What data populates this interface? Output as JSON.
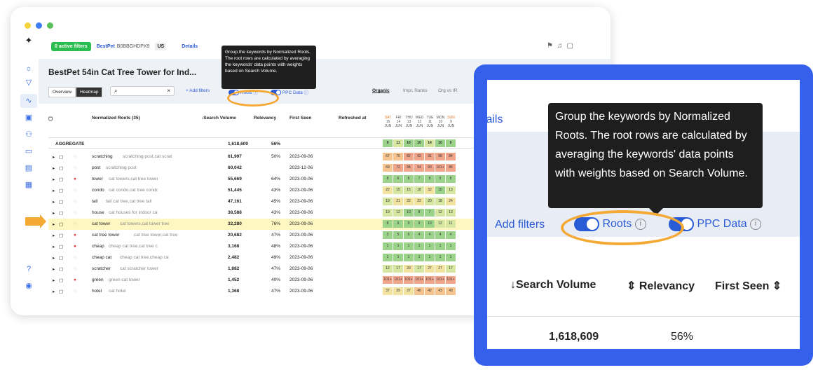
{
  "window": {
    "dot_colors": [
      "#f5d33b",
      "#3f7cf2",
      "#5ac05a"
    ]
  },
  "toolbar": {
    "filters": "0 active filters",
    "asin_prefix": "BestPet",
    "asin": "B0BBGHDPX9",
    "market": "US",
    "details": "Details"
  },
  "product": {
    "title": "BestPet 54in Cat Tree Tower for Ind..."
  },
  "tabs": {
    "overview": "Overview",
    "heatmap": "Heatmap"
  },
  "controls": {
    "add_filters": "+ Add filters",
    "roots": "Roots",
    "ppc": "PPC Data",
    "organic": "Organic",
    "impr": "Impr. Ranks",
    "orgvs": "Org vs IR"
  },
  "tooltip": "Group the keywords by Normalized Roots. The root rows are calculated by averaging the keywords' data points with weights based on Search Volume.",
  "table": {
    "headers": {
      "roots": "Normalized Roots (35)",
      "sv": "↓Search Volume",
      "rel": "Relevancy",
      "first": "First Seen",
      "refreshed": "Refreshed at"
    },
    "days": [
      [
        "SAT",
        "15",
        "JUN"
      ],
      [
        "FRI",
        "14",
        "JUN"
      ],
      [
        "THU",
        "13",
        "JUN"
      ],
      [
        "WED",
        "12",
        "JUN"
      ],
      [
        "TUE",
        "11",
        "JUN"
      ],
      [
        "MON",
        "10",
        "JUN"
      ],
      [
        "SUN",
        "9",
        "JUN"
      ]
    ],
    "aggregate": {
      "label": "AGGREGATE",
      "sv": "1,618,609",
      "rel": "56%",
      "cells": [
        "9",
        "11",
        "10",
        "10",
        "14",
        "10",
        "9"
      ]
    },
    "rows": [
      {
        "root": "scratching",
        "kw": "scratching post,cat scratc",
        "sv": "61,997",
        "rel": "50%",
        "first": "2023-09-06",
        "cells": [
          "67",
          "70",
          "82",
          "92",
          "91",
          "98",
          "84"
        ]
      },
      {
        "root": "post",
        "kw": "scratching post",
        "sv": "60,042",
        "rel": "",
        "first": "2023-12-06",
        "cells": [
          "69",
          "72",
          "84",
          "94",
          "93",
          "101+",
          "86"
        ]
      },
      {
        "root": "tower",
        "kw": "cat towers,cat tree tower,cat",
        "sv": "55,669",
        "rel": "64%",
        "first": "2023-09-06",
        "cells": [
          "8",
          "6",
          "8",
          "7",
          "8",
          "9",
          "8"
        ]
      },
      {
        "root": "condo",
        "kw": "cat condo,cat tree condo",
        "sv": "51,445",
        "rel": "43%",
        "first": "2023-09-06",
        "cells": [
          "22",
          "15",
          "15",
          "18",
          "32",
          "10",
          "13"
        ]
      },
      {
        "root": "tall",
        "kw": "tall cat tree,cat tree tall",
        "sv": "47,161",
        "rel": "45%",
        "first": "2023-09-06",
        "cells": [
          "19",
          "21",
          "22",
          "22",
          "20",
          "18",
          "24"
        ]
      },
      {
        "root": "house",
        "kw": "cat houses for indoor cats,tre",
        "sv": "38,588",
        "rel": "43%",
        "first": "2023-09-06",
        "cells": [
          "19",
          "12",
          "10",
          "8",
          "7",
          "12",
          "13"
        ]
      },
      {
        "root": "cat tower",
        "kw": "cat towers,cat tower tree,g",
        "sv": "32,280",
        "rel": "76%",
        "first": "2023-09-06",
        "cells": [
          "8",
          "9",
          "9",
          "9",
          "10",
          "12",
          "11"
        ]
      },
      {
        "root": "cat tree tower",
        "kw": "cat tree tower,cat tree",
        "sv": "20,682",
        "rel": "47%",
        "first": "2023-09-06",
        "cells": [
          "3",
          "5",
          "6",
          "4",
          "4",
          "4",
          "4"
        ]
      },
      {
        "root": "cheap",
        "kw": "cheap cat tree,cat tree cheap",
        "sv": "3,168",
        "rel": "48%",
        "first": "2023-09-06",
        "cells": [
          "1",
          "1",
          "1",
          "1",
          "1",
          "1",
          "1"
        ]
      },
      {
        "root": "cheap cat",
        "kw": "cheap cat tree,cheap cat t",
        "sv": "2,482",
        "rel": "49%",
        "first": "2023-09-06",
        "cells": [
          "1",
          "1",
          "1",
          "1",
          "1",
          "1",
          "1"
        ]
      },
      {
        "root": "scratcher",
        "kw": "cat scratcher tower",
        "sv": "1,882",
        "rel": "47%",
        "first": "2023-09-06",
        "cells": [
          "12",
          "17",
          "29",
          "17",
          "27",
          "27",
          "17"
        ]
      },
      {
        "root": "green",
        "kw": "green cat tower",
        "sv": "1,452",
        "rel": "40%",
        "first": "2023-09-06",
        "cells": [
          "101+",
          "101+",
          "101+",
          "101+",
          "101+",
          "101+",
          "101+"
        ]
      },
      {
        "root": "hotel",
        "kw": "cat hotel",
        "sv": "1,368",
        "rel": "47%",
        "first": "2023-09-06",
        "cells": [
          "37",
          "39",
          "37",
          "46",
          "42",
          "43",
          "43"
        ]
      }
    ]
  },
  "zoom": {
    "details": "tails",
    "add_filters": "Add filters",
    "roots": "Roots",
    "ppc": "PPC Data",
    "sv": "↓Search Volume",
    "rel": "Relevancy",
    "first": "First Seen",
    "sv_value": "1,618,609",
    "rel_value": "56%"
  }
}
